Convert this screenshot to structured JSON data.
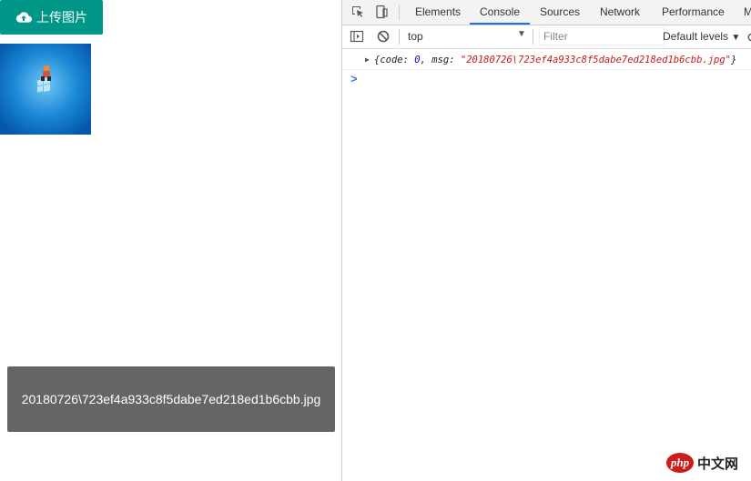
{
  "page": {
    "upload_label": "上传图片",
    "toast_text": "20180726\\723ef4a933c8f5dabe7ed218ed1b6cbb.jpg"
  },
  "devtools": {
    "tabs": [
      {
        "label": "Elements",
        "active": false
      },
      {
        "label": "Console",
        "active": true
      },
      {
        "label": "Sources",
        "active": false
      },
      {
        "label": "Network",
        "active": false
      },
      {
        "label": "Performance",
        "active": false
      },
      {
        "label": "M",
        "active": false
      }
    ],
    "context": "top",
    "filter_placeholder": "Filter",
    "levels_label": "Default levels",
    "log": {
      "open": "{",
      "k1": "code",
      "v1": "0",
      "k2": "msg",
      "v2": "\"20180726\\723ef4a933c8f5dabe7ed218ed1b6cbb.jpg\"",
      "close": "}"
    },
    "prompt_symbol": ">"
  },
  "watermark": {
    "logo": "php",
    "text": "中文网"
  },
  "colors": {
    "upload_button": "#009688",
    "toast_bg": "#656565",
    "active_tab": "#1a73e8",
    "string": "#c41a16",
    "number": "#1c00cf"
  }
}
